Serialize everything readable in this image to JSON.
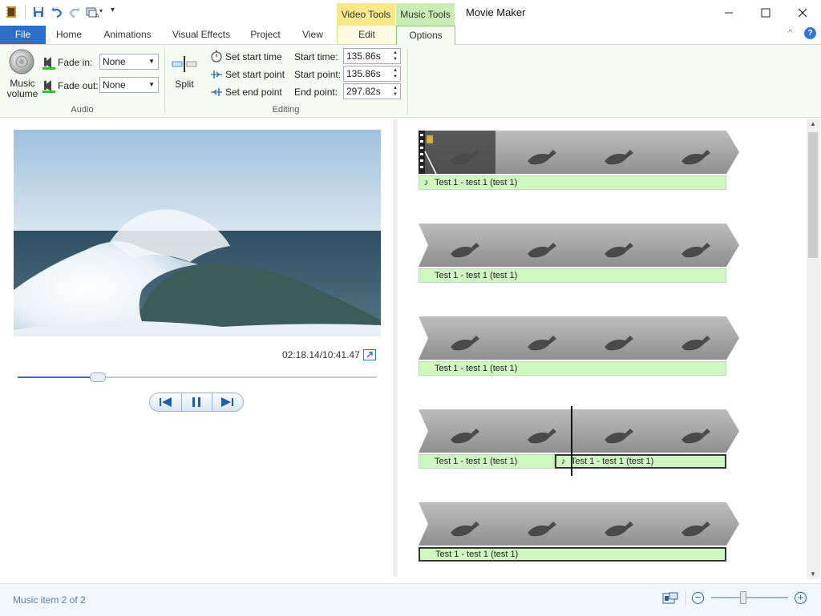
{
  "app": {
    "title": "Movie Maker"
  },
  "quick_access": {
    "icons": [
      "moviemaker-app-icon",
      "save-icon",
      "undo-icon",
      "redo-icon",
      "snapshot-icon",
      "customize-dropdown-icon"
    ]
  },
  "context_tabs": {
    "video_tools": "Video Tools",
    "music_tools": "Music Tools"
  },
  "window_controls": {
    "minimize": "—",
    "maximize": "☐",
    "close": "✕"
  },
  "tabs": [
    {
      "label": "File"
    },
    {
      "label": "Home"
    },
    {
      "label": "Animations"
    },
    {
      "label": "Visual Effects"
    },
    {
      "label": "Project"
    },
    {
      "label": "View"
    },
    {
      "label": "Edit"
    },
    {
      "label": "Options"
    }
  ],
  "ribbon": {
    "audio": {
      "group_label": "Audio",
      "music_volume_line1": "Music",
      "music_volume_line2": "volume",
      "fade_in_label": "Fade in:",
      "fade_in_value": "None",
      "fade_out_label": "Fade out:",
      "fade_out_value": "None"
    },
    "editing": {
      "group_label": "Editing",
      "split_label": "Split",
      "set_start_time": "Set start time",
      "set_start_point": "Set start point",
      "set_end_point": "Set end point",
      "start_time_label": "Start time:",
      "start_time_value": "135.86s",
      "start_point_label": "Start point:",
      "start_point_value": "135.86s",
      "end_point_label": "End point:",
      "end_point_value": "297.82s"
    }
  },
  "player": {
    "time_readout": "02:18.14/10:41.47",
    "seek_fraction": 0.22
  },
  "timeline": {
    "rows": [
      {
        "music": [
          "Test 1 - test 1 (test 1)"
        ]
      },
      {
        "music": [
          "Test 1 - test 1 (test 1)"
        ]
      },
      {
        "music": [
          "Test 1 - test 1 (test 1)"
        ]
      },
      {
        "music": [
          "Test 1 - test 1 (test 1)",
          "Test 1 - test 1 (test 1)"
        ]
      },
      {
        "music": [
          "Test 1 - test 1 (test 1)"
        ]
      }
    ]
  },
  "status": {
    "text": "Music item 2 of 2",
    "zoom_fraction": 0.42
  },
  "colors": {
    "file_tab": "#2b6fc8",
    "music_tools": "#c9ecb6",
    "video_tools": "#f7e98a",
    "music_bar": "#cef7c2",
    "status_text": "#5b7f9c"
  }
}
